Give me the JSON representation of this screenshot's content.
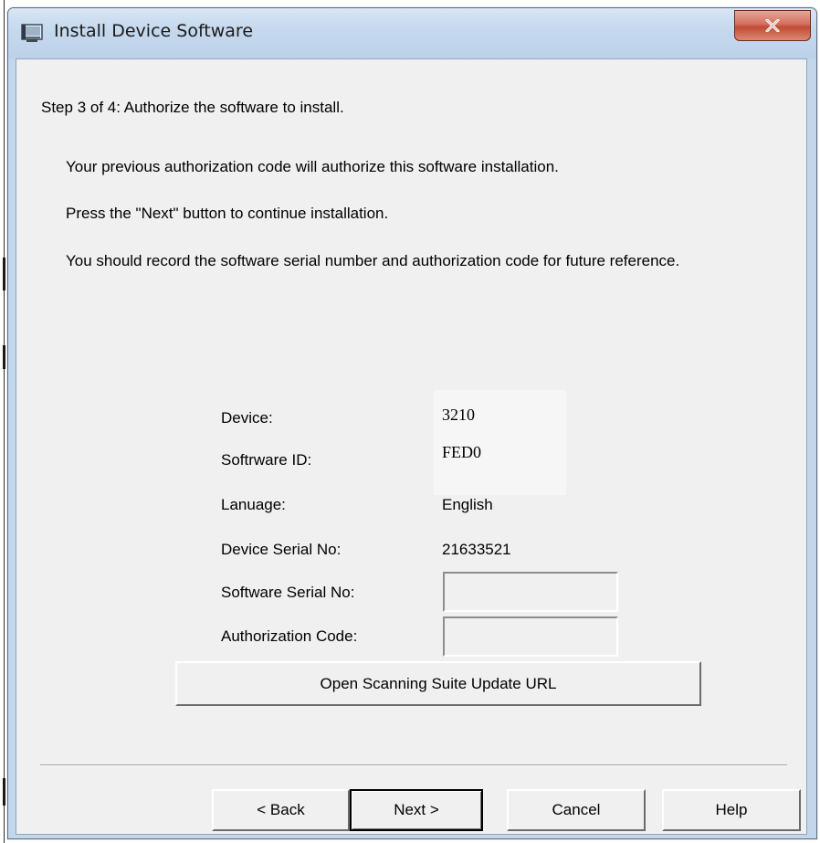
{
  "window": {
    "title": "Install Device Software",
    "icon": "installer-window-icon",
    "close_icon": "close-x-icon"
  },
  "step_heading": "Step 3 of 4:  Authorize the software to install.",
  "messages": [
    "Your previous authorization code will authorize this software installation.",
    "Press the \"Next\" button to continue installation.",
    "You should record the software serial number and authorization code for future reference."
  ],
  "details": {
    "device_label": "Device:",
    "device_value": "3210",
    "software_id_label": "Softrware ID:",
    "software_id_value": "FED0",
    "language_label": "Lanuage:",
    "language_value": "English",
    "device_serial_label": "Device Serial No:",
    "device_serial_value": "21633521",
    "software_serial_label": "Software Serial No:",
    "software_serial_value": "",
    "authorization_label": "Authorization Code:",
    "authorization_value": ""
  },
  "buttons": {
    "open_url": "Open Scanning Suite Update URL",
    "back": "< Back",
    "next": "Next >",
    "cancel": "Cancel",
    "help": "Help"
  },
  "colors": {
    "titlebar": "#c6d9ee",
    "client_background": "#f0f0f0",
    "close_button": "#c24a34"
  }
}
